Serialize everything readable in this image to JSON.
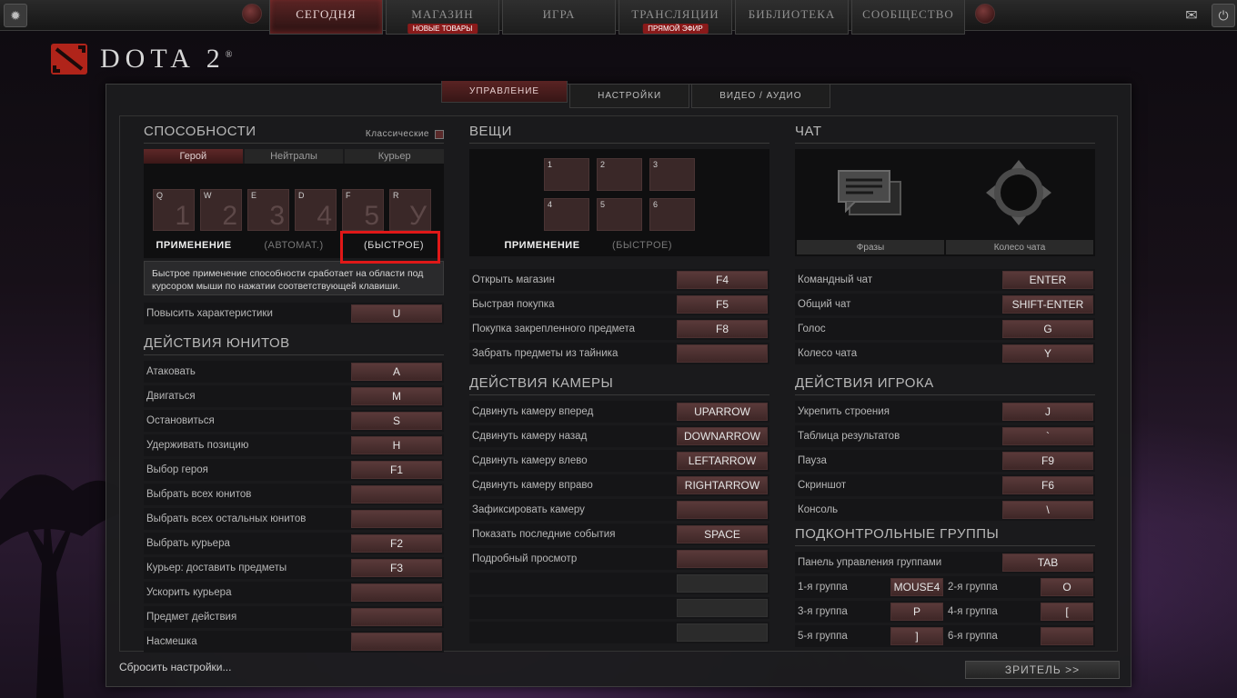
{
  "nav": {
    "items": [
      {
        "label": "СЕГОДНЯ",
        "badge": ""
      },
      {
        "label": "МАГАЗИН",
        "badge": "НОВЫЕ ТОВАРЫ"
      },
      {
        "label": "ИГРА",
        "badge": ""
      },
      {
        "label": "ТРАНСЛЯЦИИ",
        "badge": "ПРЯМОЙ ЭФИР"
      },
      {
        "label": "БИБЛИОТЕКА",
        "badge": ""
      },
      {
        "label": "СООБЩЕСТВО",
        "badge": ""
      }
    ],
    "active": "СЕГОДНЯ"
  },
  "logo": {
    "text": "DOTA 2",
    "reg": "®"
  },
  "tabs": [
    {
      "label": "УПРАВЛЕНИЕ"
    },
    {
      "label": "НАСТРОЙКИ"
    },
    {
      "label": "ВИДЕО / АУДИО"
    }
  ],
  "abilities": {
    "title": "СПОСОБНОСТИ",
    "classic_label": "Классические",
    "subtabs": [
      "Герой",
      "Нейтралы",
      "Курьер"
    ],
    "slots": [
      {
        "hotkey": "Q",
        "number": "1"
      },
      {
        "hotkey": "W",
        "number": "2"
      },
      {
        "hotkey": "E",
        "number": "3"
      },
      {
        "hotkey": "D",
        "number": "4"
      },
      {
        "hotkey": "F",
        "number": "5"
      },
      {
        "hotkey": "R",
        "number": "У"
      }
    ],
    "modes": [
      "ПРИМЕНЕНИЕ",
      "(АВТОМАТ.)",
      "(БЫСТРОЕ)"
    ],
    "tooltip": "Быстрое применение способности сработает на области под курсором мыши по нажатии соответствующей клавиши.",
    "upgrade_label": "Повысить характеристики",
    "upgrade_key": "U"
  },
  "unit_actions": {
    "title": "ДЕЙСТВИЯ ЮНИТОВ",
    "rows": [
      {
        "label": "Атаковать",
        "key": "A"
      },
      {
        "label": "Двигаться",
        "key": "M"
      },
      {
        "label": "Остановиться",
        "key": "S"
      },
      {
        "label": "Удерживать позицию",
        "key": "H"
      },
      {
        "label": "Выбор героя",
        "key": "F1"
      },
      {
        "label": "Выбрать всех юнитов",
        "key": ""
      },
      {
        "label": "Выбрать всех остальных юнитов",
        "key": ""
      },
      {
        "label": "Выбрать курьера",
        "key": "F2"
      },
      {
        "label": "Курьер: доставить предметы",
        "key": "F3"
      },
      {
        "label": "Ускорить курьера",
        "key": ""
      },
      {
        "label": "Предмет действия",
        "key": ""
      },
      {
        "label": "Насмешка",
        "key": ""
      }
    ]
  },
  "items": {
    "title": "ВЕЩИ",
    "slots": [
      "1",
      "2",
      "3",
      "4",
      "5",
      "6"
    ],
    "modes": [
      "ПРИМЕНЕНИЕ",
      "(БЫСТРОЕ)"
    ],
    "rows": [
      {
        "label": "Открыть магазин",
        "key": "F4"
      },
      {
        "label": "Быстрая покупка",
        "key": "F5"
      },
      {
        "label": "Покупка закрепленного предмета",
        "key": "F8"
      },
      {
        "label": "Забрать предметы из тайника",
        "key": ""
      }
    ]
  },
  "camera": {
    "title": "ДЕЙСТВИЯ КАМЕРЫ",
    "rows": [
      {
        "label": "Сдвинуть камеру вперед",
        "key": "UPARROW"
      },
      {
        "label": "Сдвинуть камеру назад",
        "key": "DOWNARROW"
      },
      {
        "label": "Сдвинуть камеру влево",
        "key": "LEFTARROW"
      },
      {
        "label": "Сдвинуть камеру вправо",
        "key": "RIGHTARROW"
      },
      {
        "label": "Зафиксировать камеру",
        "key": ""
      },
      {
        "label": "Показать последние события",
        "key": "SPACE"
      },
      {
        "label": "Подробный просмотр",
        "key": ""
      },
      {
        "label": "",
        "key": ""
      },
      {
        "label": "",
        "key": ""
      },
      {
        "label": "",
        "key": ""
      }
    ]
  },
  "chat": {
    "title": "ЧАТ",
    "buttons": [
      "Фразы",
      "Колесо чата"
    ],
    "rows": [
      {
        "label": "Командный чат",
        "key": "ENTER"
      },
      {
        "label": "Общий чат",
        "key": "SHIFT-ENTER"
      },
      {
        "label": "Голос",
        "key": "G"
      },
      {
        "label": "Колесо чата",
        "key": "Y"
      }
    ]
  },
  "player_actions": {
    "title": "ДЕЙСТВИЯ ИГРОКА",
    "rows": [
      {
        "label": "Укрепить строения",
        "key": "J"
      },
      {
        "label": "Таблица результатов",
        "key": "`"
      },
      {
        "label": "Пауза",
        "key": "F9"
      },
      {
        "label": "Скриншот",
        "key": "F6"
      },
      {
        "label": "Консоль",
        "key": "\\"
      }
    ]
  },
  "control_groups": {
    "title": "ПОДКОНТРОЛЬНЫЕ ГРУППЫ",
    "panel_label": "Панель управления группами",
    "panel_key": "TAB",
    "groups": [
      [
        {
          "label": "1-я группа",
          "key": "MOUSE4"
        },
        {
          "label": "2-я группа",
          "key": "O"
        }
      ],
      [
        {
          "label": "3-я группа",
          "key": "P"
        },
        {
          "label": "4-я группа",
          "key": "["
        }
      ],
      [
        {
          "label": "5-я группа",
          "key": "]"
        },
        {
          "label": "6-я группа",
          "key": ""
        }
      ]
    ]
  },
  "footer": {
    "reset_label": "Сбросить настройки...",
    "spectator_label": "ЗРИТЕЛЬ >>"
  }
}
